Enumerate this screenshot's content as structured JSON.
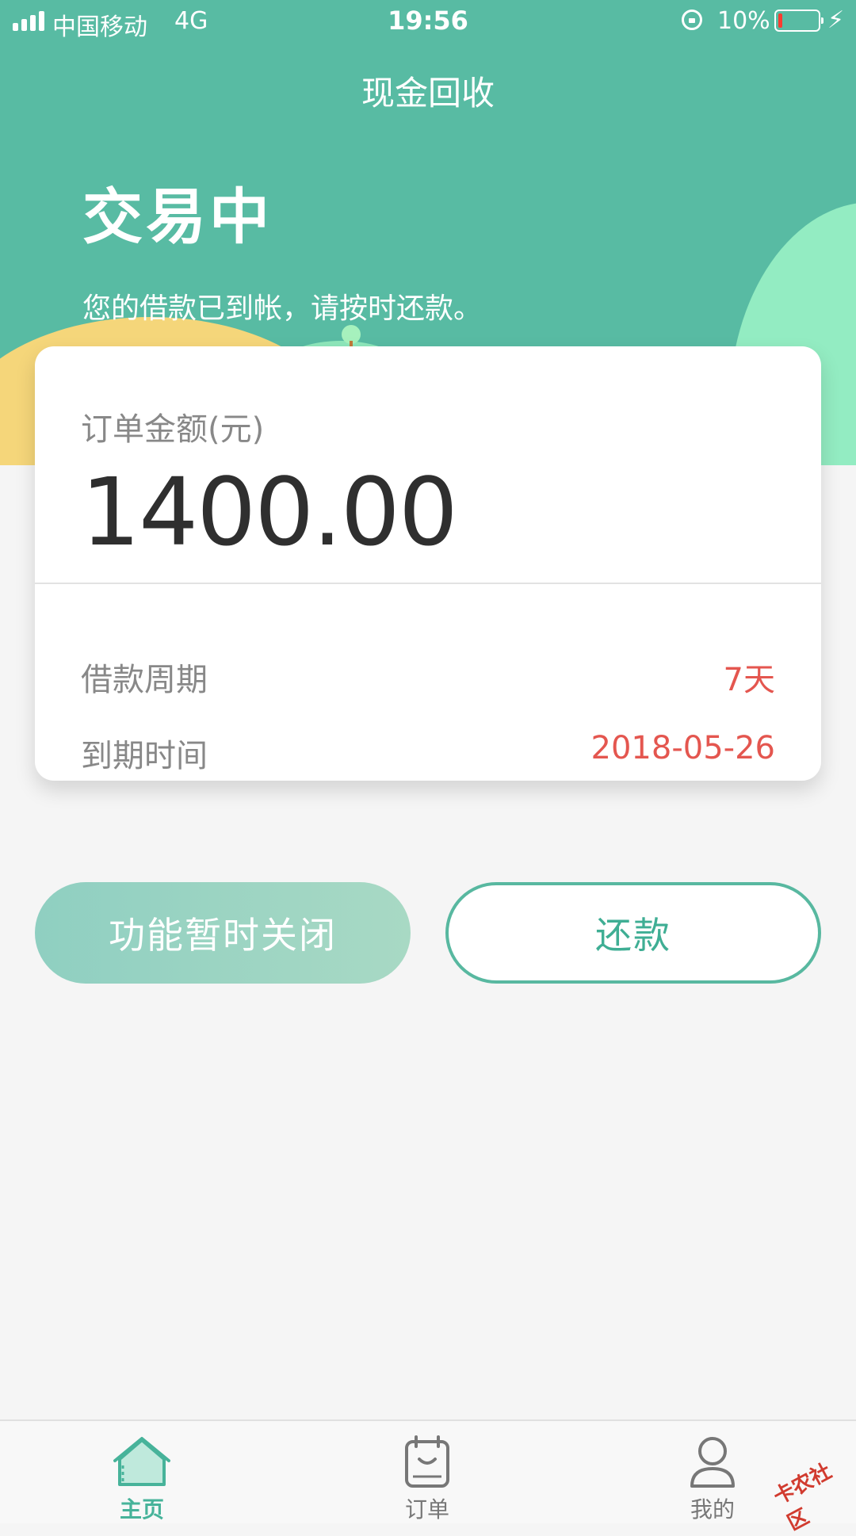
{
  "status_bar": {
    "carrier": "中国移动",
    "network": "4G",
    "time": "19:56",
    "battery": "10%",
    "icons": [
      "signal-icon",
      "orientation-lock-icon",
      "battery-icon",
      "charging-icon"
    ]
  },
  "header": {
    "title": "现金回收"
  },
  "hero": {
    "status": "交易中",
    "message": "您的借款已到帐，请按时还款。"
  },
  "order_card": {
    "amount_label": "订单金额(元)",
    "amount_value": "1400.00",
    "rows": [
      {
        "label": "借款周期",
        "value": "7天"
      },
      {
        "label": "到期时间",
        "value": "2018-05-26"
      }
    ]
  },
  "actions": {
    "disabled_label": "功能暂时关闭",
    "repay_label": "还款"
  },
  "tabbar": {
    "items": [
      {
        "label": "主页",
        "icon": "home-icon",
        "active": true
      },
      {
        "label": "订单",
        "icon": "order-icon",
        "active": false
      },
      {
        "label": "我的",
        "icon": "user-icon",
        "active": false
      }
    ]
  },
  "watermark": {
    "text": "卡农社区"
  },
  "colors": {
    "brand": "#58bba3",
    "accent_red": "#e4564f",
    "active_tab": "#47b39a"
  }
}
